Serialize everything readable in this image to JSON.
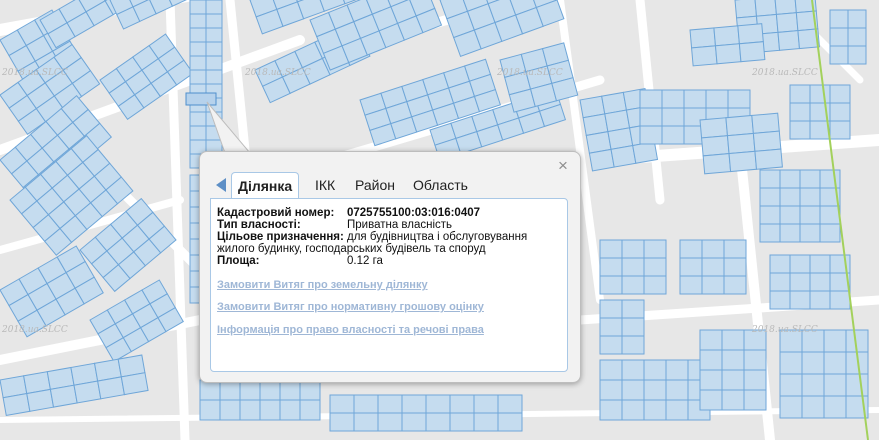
{
  "watermark": "2018.ua.SLCC",
  "colors": {
    "parcel_fill": "#c5dcef",
    "parcel_stroke": "#6fa6d8",
    "road": "#ffffff",
    "background": "#e7e7e7",
    "boundary_line": "#a3d15c"
  },
  "popup": {
    "close_icon": "×",
    "back_icon": "chevron-left-icon",
    "tabs": [
      {
        "label": "Ділянка",
        "active": true
      },
      {
        "label": "ІКК",
        "active": false
      },
      {
        "label": "Район",
        "active": false
      },
      {
        "label": "Область",
        "active": false
      }
    ],
    "details": {
      "cadastral_label": "Кадастровий номер:",
      "cadastral_value": "0725755100:03:016:0407",
      "ownership_label": "Тип власності:",
      "ownership_value": "Приватна власність",
      "purpose_label": "Цільове призначення:",
      "purpose_value_1": "для будівництва і обслуговування",
      "purpose_value_2": "жилого будинку, господарських будівель та споруд",
      "area_label": "Площа:",
      "area_value": "0.12 га"
    },
    "links": [
      "Замовити Витяг про земельну ділянку",
      "Замовити Витяг про нормативну грошову оцінку",
      "Інформація про право власності та речові права"
    ]
  }
}
